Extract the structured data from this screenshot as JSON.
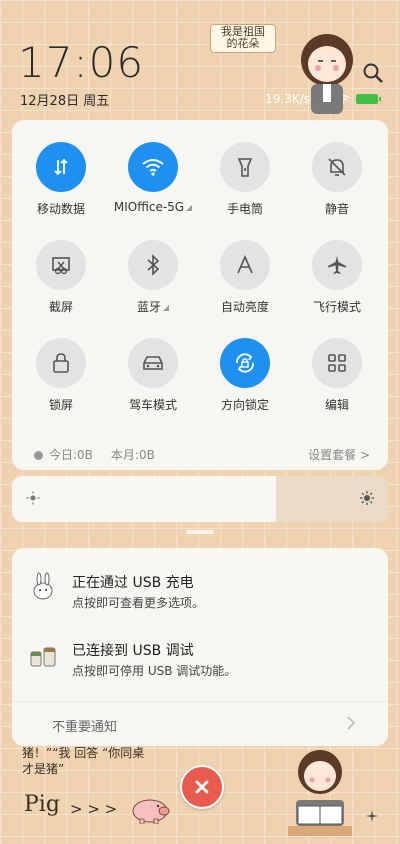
{
  "status": {
    "time": "17:06",
    "date": "12月28日 周五",
    "speed": "19.3K/s"
  },
  "sticker": {
    "note_line1": "我是祖国",
    "note_line2": "的花朵"
  },
  "toggles": [
    {
      "label": "移动数据",
      "icon": "mobile-data-icon",
      "on": true
    },
    {
      "label": "MIOffice-5G",
      "icon": "wifi-icon",
      "on": true
    },
    {
      "label": "手电筒",
      "icon": "flashlight-icon",
      "on": false
    },
    {
      "label": "静音",
      "icon": "mute-bell-icon",
      "on": false
    },
    {
      "label": "截屏",
      "icon": "screenshot-icon",
      "on": false
    },
    {
      "label": "蓝牙",
      "icon": "bluetooth-icon",
      "on": false
    },
    {
      "label": "自动亮度",
      "icon": "auto-brightness-icon",
      "on": false
    },
    {
      "label": "飞行模式",
      "icon": "airplane-icon",
      "on": false
    },
    {
      "label": "锁屏",
      "icon": "lock-icon",
      "on": false
    },
    {
      "label": "驾车模式",
      "icon": "car-icon",
      "on": false
    },
    {
      "label": "方向锁定",
      "icon": "rotation-lock-icon",
      "on": true
    },
    {
      "label": "编辑",
      "icon": "edit-grid-icon",
      "on": false
    }
  ],
  "data_usage": {
    "today": "今日:0B",
    "month": "本月:0B",
    "settings": "设置套餐 >"
  },
  "notifications": [
    {
      "title": "正在通过 USB 充电",
      "subtitle": "点按即可查看更多选项。"
    },
    {
      "title": "已连接到 USB 调试",
      "subtitle": "点按即可停用 USB 调试功能。"
    }
  ],
  "notif_footer": "不重要通知",
  "wallpaper": {
    "line1": "猪！”“我 回答 “你同桌",
    "line2": "才是猪”",
    "pig_text": "Pig",
    "arrows": "> > >"
  },
  "colors": {
    "accent": "#1e91f0",
    "background": "#efd3b1",
    "close": "#e85b4e"
  }
}
